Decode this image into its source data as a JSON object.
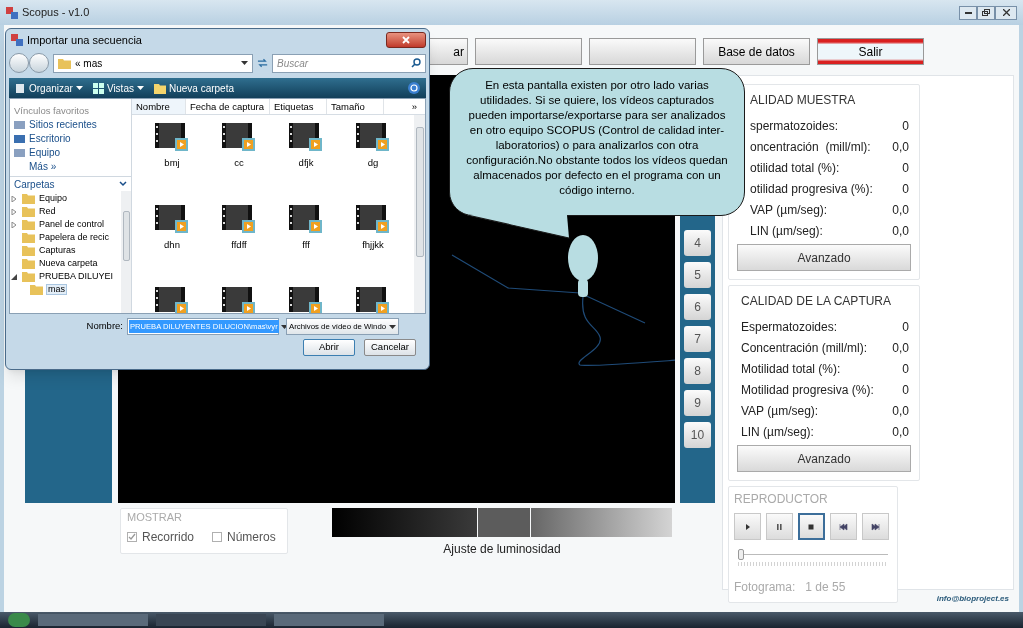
{
  "window": {
    "title": "Scopus - v1.0"
  },
  "toolbar": [
    {
      "label": "ar",
      "kind": "normal"
    },
    {
      "kind": "normal"
    },
    {
      "kind": "normal"
    },
    {
      "label": "Base de datos",
      "kind": "normal"
    },
    {
      "label": "Salir",
      "kind": "exit"
    }
  ],
  "sequence_buttons": [
    "4",
    "5",
    "6",
    "7",
    "8",
    "9",
    "10"
  ],
  "sample_quality": {
    "title": "ALIDAD MUESTRA",
    "rows": [
      {
        "label": "spermatozoides:",
        "value": "0"
      },
      {
        "label": "oncentración  (mill/ml):",
        "value": "0,0"
      },
      {
        "label": "otilidad total (%):",
        "value": "0"
      },
      {
        "label": "otilidad progresiva (%):",
        "value": "0"
      },
      {
        "label": "VAP (µm/seg):",
        "value": "0,0"
      },
      {
        "label": "LIN (µm/seg):",
        "value": "0,0"
      }
    ],
    "button": "Avanzado"
  },
  "capture_quality": {
    "title": "CALIDAD DE LA CAPTURA",
    "rows": [
      {
        "label": "Espermatozoides:",
        "value": "0"
      },
      {
        "label": "Concentración (mill/ml):",
        "value": "0,0"
      },
      {
        "label": "Motilidad total (%):",
        "value": "0"
      },
      {
        "label": "Motilidad progresiva (%):",
        "value": "0"
      },
      {
        "label": "VAP (µm/seg):",
        "value": "0,0"
      },
      {
        "label": "LIN (µm/seg):",
        "value": "0,0"
      }
    ],
    "button": "Avanzado"
  },
  "player": {
    "title": "REPRODUCTOR",
    "controls": [
      {
        "kind": "play",
        "selected": false
      },
      {
        "kind": "pause",
        "selected": false
      },
      {
        "kind": "stop",
        "selected": true
      },
      {
        "kind": "previous",
        "selected": false
      },
      {
        "kind": "next",
        "selected": false
      }
    ],
    "position": {
      "level": 0
    },
    "frame_label": "Fotograma:",
    "frame_value": "1 de 55"
  },
  "show": {
    "title": "MOSTRAR",
    "options": [
      {
        "label": "Recorrido",
        "checked": true
      },
      {
        "label": "Números",
        "checked": false
      }
    ]
  },
  "brightness": {
    "label": "Ajuste de luminosidad"
  },
  "footer": {
    "email": "info@bioproject.es"
  },
  "callout": {
    "text": "En esta pantalla existen por otro lado varias utilidades. Si se quiere, los vídeos capturados pueden importarse/exportarse para ser analizados en otro equipo SCOPUS (Control de calidad inter-laboratorios) o para analizarlos con otra configuración.No obstante todos los vídeos quedan almacenados por defecto en el programa con un código interno."
  },
  "dialog": {
    "title": "Importar una secuencia",
    "path": "« mas",
    "search": {
      "placeholder": "Buscar"
    },
    "commands": [
      "Organizar",
      "Vistas",
      "Nueva carpeta"
    ],
    "favorites_title": "Vínculos favoritos",
    "favorites": [
      "Sitios recientes",
      "Escritorio",
      "Equipo"
    ],
    "more": "Más »",
    "folders_title": "Carpetas",
    "folders": [
      {
        "label": "Equipo",
        "kind": "branch",
        "expanded": false,
        "selected": false
      },
      {
        "label": "Red",
        "kind": "branch",
        "expanded": false,
        "selected": false
      },
      {
        "label": "Panel de control",
        "kind": "branch",
        "expanded": false,
        "selected": false
      },
      {
        "label": "Papelera de recic",
        "kind": "leaf",
        "selected": false
      },
      {
        "label": "Capturas",
        "kind": "leaf",
        "selected": false
      },
      {
        "label": "Nueva carpeta",
        "kind": "leaf",
        "selected": false
      },
      {
        "label": "PRUEBA DILUYEI",
        "kind": "branch",
        "expanded": true,
        "selected": false,
        "children": [
          {
            "label": "mas",
            "kind": "leaf",
            "selected": true
          }
        ]
      }
    ],
    "columns": [
      "Nombre",
      "Fecha de captura",
      "Etiquetas",
      "Tamaño"
    ],
    "more_columns": "»",
    "files": [
      {
        "kind": "video",
        "name": "bmj"
      },
      {
        "kind": "video",
        "name": "cc"
      },
      {
        "kind": "video",
        "name": "dfjk"
      },
      {
        "kind": "video",
        "name": "dg"
      },
      {
        "kind": "video",
        "name": "dhn"
      },
      {
        "kind": "video",
        "name": "ffdff"
      },
      {
        "kind": "video",
        "name": "fff"
      },
      {
        "kind": "video",
        "name": "fhjjkk"
      },
      {
        "kind": "video"
      },
      {
        "kind": "video"
      },
      {
        "kind": "video"
      },
      {
        "kind": "video"
      }
    ],
    "filename_label": "Nombre:",
    "filename": "PRUEBA DILUYENTES DILUCION\\mas\\vyr",
    "filetype": "Archivos de vídeo de Windo",
    "buttons": [
      "Abrir",
      "Cancelar"
    ]
  }
}
